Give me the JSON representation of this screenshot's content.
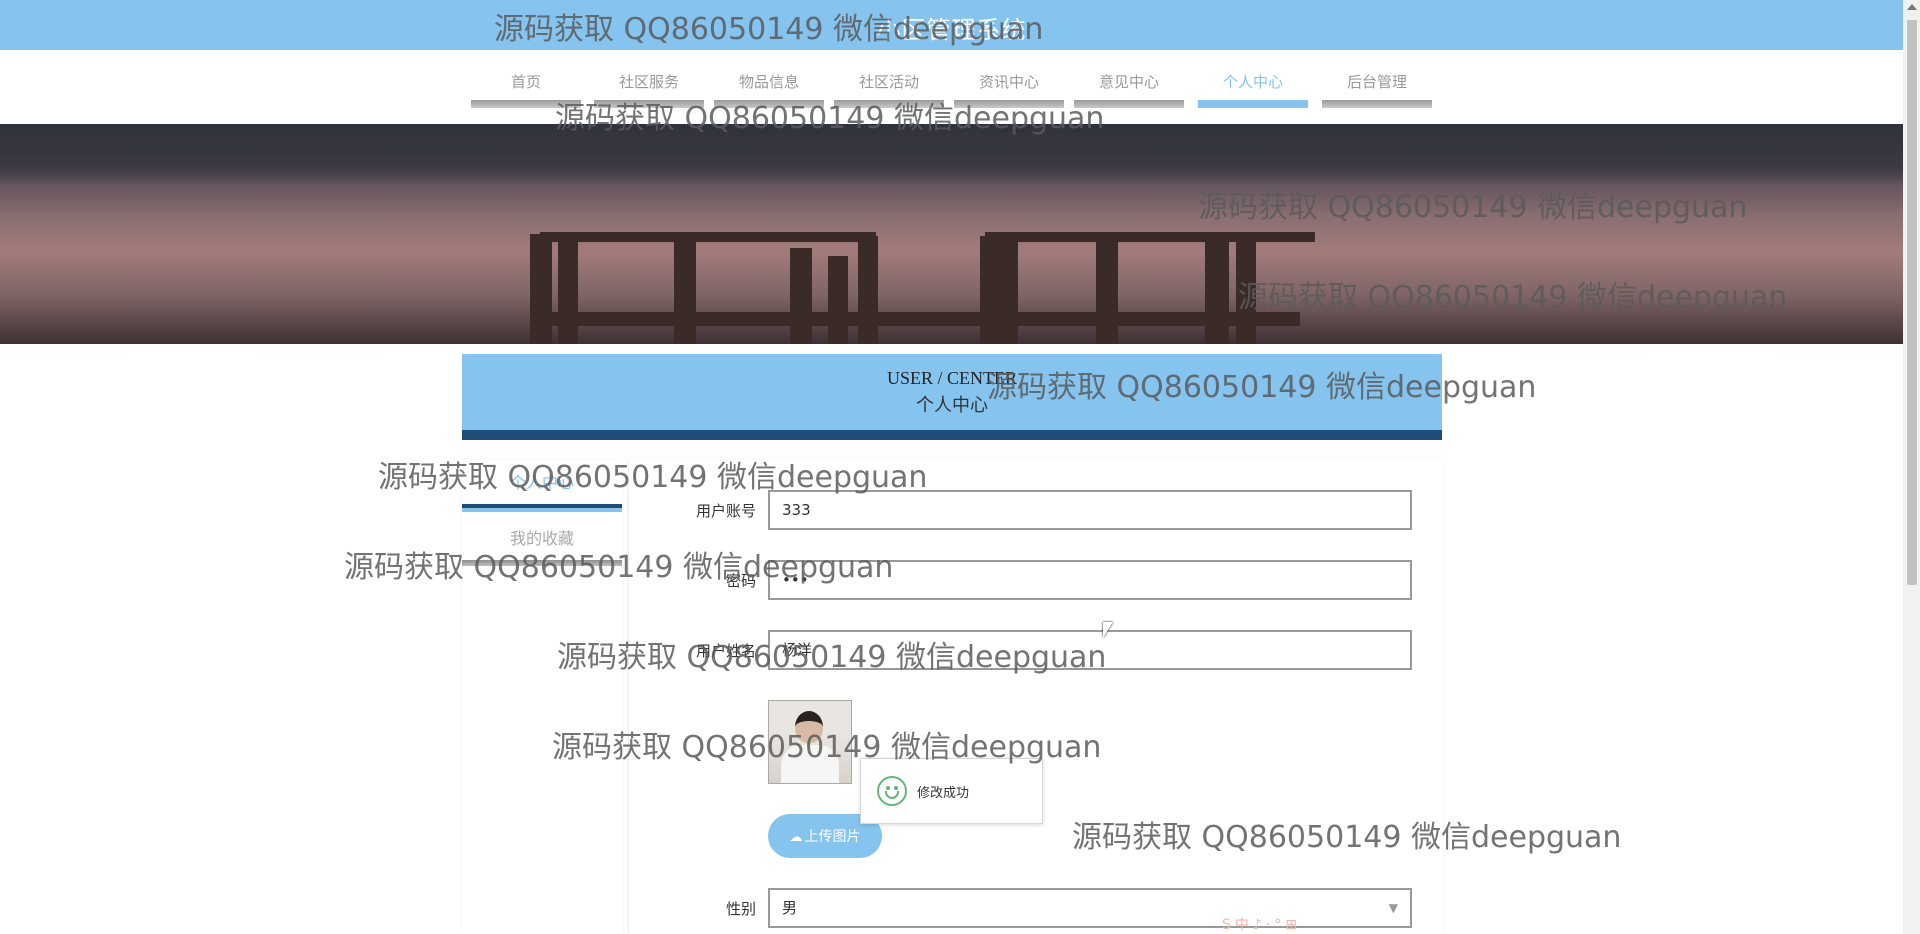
{
  "site": {
    "title": "小区管理系统"
  },
  "nav": [
    {
      "label": "首页"
    },
    {
      "label": "社区服务"
    },
    {
      "label": "物品信息"
    },
    {
      "label": "社区活动"
    },
    {
      "label": "资讯中心"
    },
    {
      "label": "意见中心"
    },
    {
      "label": "个人中心",
      "active": true
    },
    {
      "label": "后台管理"
    }
  ],
  "header": {
    "en": "USER / CENTER",
    "zh": "个人中心"
  },
  "sidebar": [
    {
      "label": "个人中心",
      "active": true
    },
    {
      "label": "我的收藏"
    }
  ],
  "form": {
    "account_label": "用户账号",
    "account_value": "333",
    "password_label": "密码",
    "password_value": "•••",
    "name_label": "用户姓名",
    "name_value": "杨洋",
    "upload_label": "上传图片",
    "gender_label": "性别",
    "gender_value": "男"
  },
  "toast": {
    "message": "修改成功"
  },
  "watermark": "源码获取 QQ86050149 微信deepguan",
  "ime_toolbar": "S中♪·°⊞",
  "colors": {
    "accent": "#84c4ef",
    "dark": "#1c4e77",
    "success": "#5fb878"
  }
}
